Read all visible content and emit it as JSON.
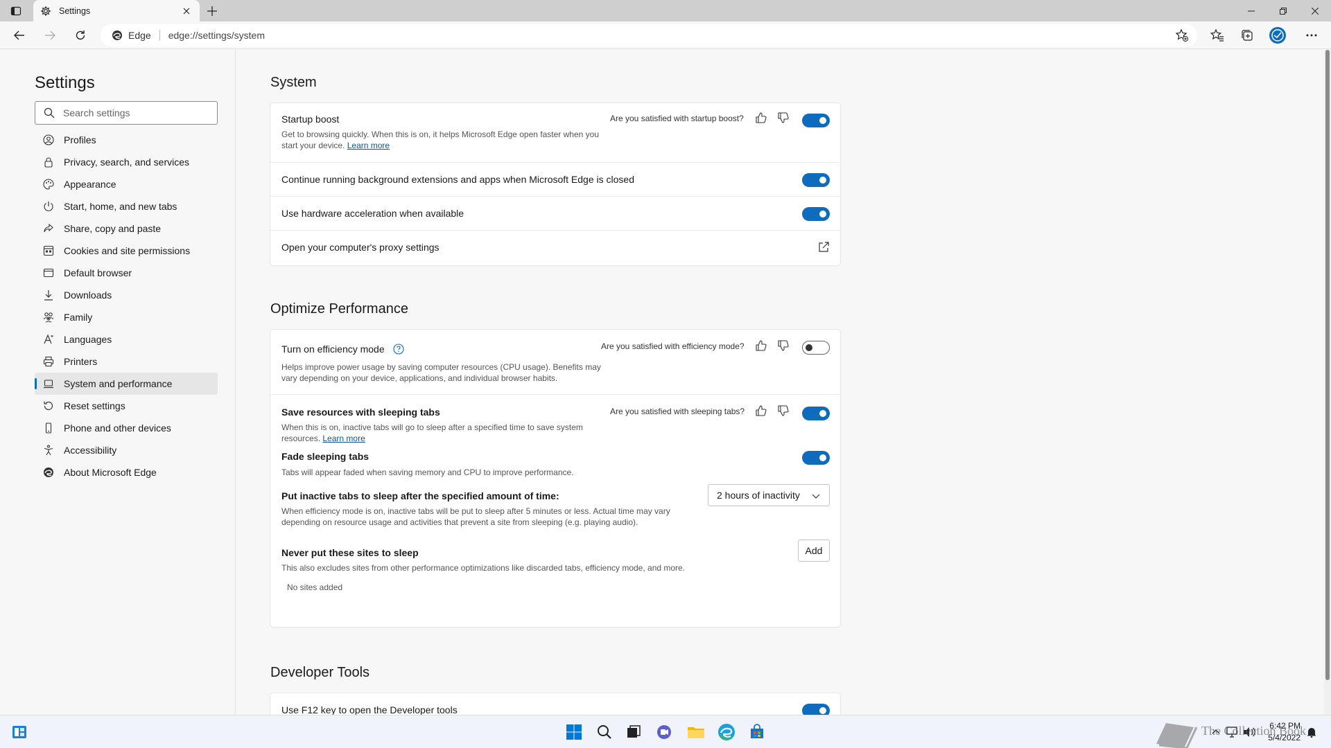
{
  "tab": {
    "title": "Settings"
  },
  "addressbar": {
    "site_label": "Edge",
    "url": "edge://settings/system"
  },
  "sidebar": {
    "title": "Settings",
    "search_placeholder": "Search settings",
    "items": [
      {
        "label": "Profiles",
        "icon": "profile-icon"
      },
      {
        "label": "Privacy, search, and services",
        "icon": "lock-icon"
      },
      {
        "label": "Appearance",
        "icon": "palette-icon"
      },
      {
        "label": "Start, home, and new tabs",
        "icon": "power-icon"
      },
      {
        "label": "Share, copy and paste",
        "icon": "share-icon"
      },
      {
        "label": "Cookies and site permissions",
        "icon": "cookies-icon"
      },
      {
        "label": "Default browser",
        "icon": "browser-icon"
      },
      {
        "label": "Downloads",
        "icon": "download-icon"
      },
      {
        "label": "Family",
        "icon": "family-icon"
      },
      {
        "label": "Languages",
        "icon": "languages-icon"
      },
      {
        "label": "Printers",
        "icon": "printer-icon"
      },
      {
        "label": "System and performance",
        "icon": "laptop-icon",
        "active": true
      },
      {
        "label": "Reset settings",
        "icon": "reset-icon"
      },
      {
        "label": "Phone and other devices",
        "icon": "phone-icon"
      },
      {
        "label": "Accessibility",
        "icon": "accessibility-icon"
      },
      {
        "label": "About Microsoft Edge",
        "icon": "edge-logo-icon"
      }
    ]
  },
  "system": {
    "heading": "System",
    "startup_boost": {
      "title": "Startup boost",
      "desc_1": "Get to browsing quickly. When this is on, it helps Microsoft Edge open faster when you",
      "desc_2": "start your device.",
      "learn_more": "Learn more",
      "feedback": "Are you satisfied with startup boost?",
      "enabled": true
    },
    "background_extensions": {
      "title": "Continue running background extensions and apps when Microsoft Edge is closed",
      "enabled": true
    },
    "hardware_accel": {
      "title": "Use hardware acceleration when available",
      "enabled": true
    },
    "proxy": {
      "title": "Open your computer's proxy settings"
    }
  },
  "optimize": {
    "heading": "Optimize Performance",
    "efficiency": {
      "title": "Turn on efficiency mode",
      "desc_1": "Helps improve power usage by saving computer resources (CPU usage). Benefits may",
      "desc_2": "vary depending on your device, applications, and individual browser habits.",
      "feedback": "Are you satisfied with efficiency mode?",
      "enabled": false
    },
    "sleeping_tabs": {
      "title": "Save resources with sleeping tabs",
      "desc_1": "When this is on, inactive tabs will go to sleep after a specified time to save system",
      "desc_2": "resources.",
      "learn_more": "Learn more",
      "feedback": "Are you satisfied with sleeping tabs?",
      "enabled": true
    },
    "fade": {
      "title": "Fade sleeping tabs",
      "desc": "Tabs will appear faded when saving memory and CPU to improve performance.",
      "enabled": true
    },
    "sleep_after": {
      "title": "Put inactive tabs to sleep after the specified amount of time:",
      "desc_1": "When efficiency mode is on, inactive tabs will be put to sleep after 5 minutes or less. Actual time may vary",
      "desc_2": "depending on resource usage and activities that prevent a site from sleeping (e.g. playing audio).",
      "selected": "2 hours of inactivity"
    },
    "never_sleep": {
      "title": "Never put these sites to sleep",
      "desc": "This also excludes sites from other performance optimizations like discarded tabs, efficiency mode, and more.",
      "add_label": "Add",
      "empty": "No sites added"
    }
  },
  "devtools": {
    "heading": "Developer Tools",
    "f12": {
      "title": "Use F12 key to open the Developer tools",
      "enabled": true
    }
  },
  "tray": {
    "time": "6:42 PM",
    "date": "5/4/2022"
  },
  "watermark": "The Collection Book",
  "colors": {
    "accent": "#0f6cbd",
    "link": "#0f548c",
    "page_bg": "#f7f7f7"
  }
}
